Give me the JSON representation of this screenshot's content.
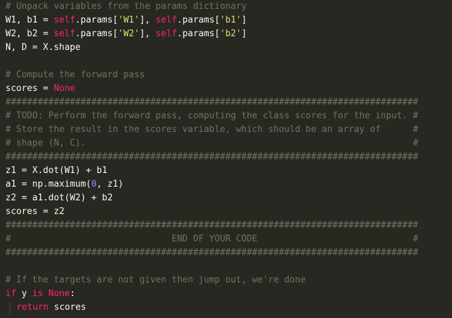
{
  "editor": {
    "lines": [
      {
        "text": "# Unpack variables from the params dictionary"
      },
      {
        "a": "W1, b1 = ",
        "b": "self",
        "c": ".params[",
        "d": "'W1'",
        "e": "], ",
        "f": "self",
        "g": ".params[",
        "h": "'b1'",
        "i": "]"
      },
      {
        "a": "W2, b2 = ",
        "b": "self",
        "c": ".params[",
        "d": "'W2'",
        "e": "], ",
        "f": "self",
        "g": ".params[",
        "h": "'b2'",
        "i": "]"
      },
      {
        "text": "N, D = X.shape"
      },
      {
        "text": ""
      },
      {
        "text": "# Compute the forward pass"
      },
      {
        "a": "scores = ",
        "b": "None"
      },
      {
        "text": "#############################################################################"
      },
      {
        "text": "# TODO: Perform the forward pass, computing the class scores for the input. #"
      },
      {
        "text": "# Store the result in the scores variable, which should be an array of      #"
      },
      {
        "text": "# shape (N, C).                                                             #"
      },
      {
        "text": "#############################################################################"
      },
      {
        "text": "z1 = X.dot(W1) + b1"
      },
      {
        "a": "a1 = np.maximum(",
        "b": "0",
        "c": ", z1)"
      },
      {
        "text": "z2 = a1.dot(W2) + b2"
      },
      {
        "text": "scores = z2"
      },
      {
        "text": "#############################################################################"
      },
      {
        "text": "#                              END OF YOUR CODE                             #"
      },
      {
        "text": "#############################################################################"
      },
      {
        "text": ""
      },
      {
        "text": "# If the targets are not given then jump out, we're done"
      },
      {
        "a": "if",
        "b": " y ",
        "c": "is",
        "d": " ",
        "e": "None",
        "f": ":"
      },
      {
        "a": "return",
        "b": " scores"
      }
    ]
  }
}
